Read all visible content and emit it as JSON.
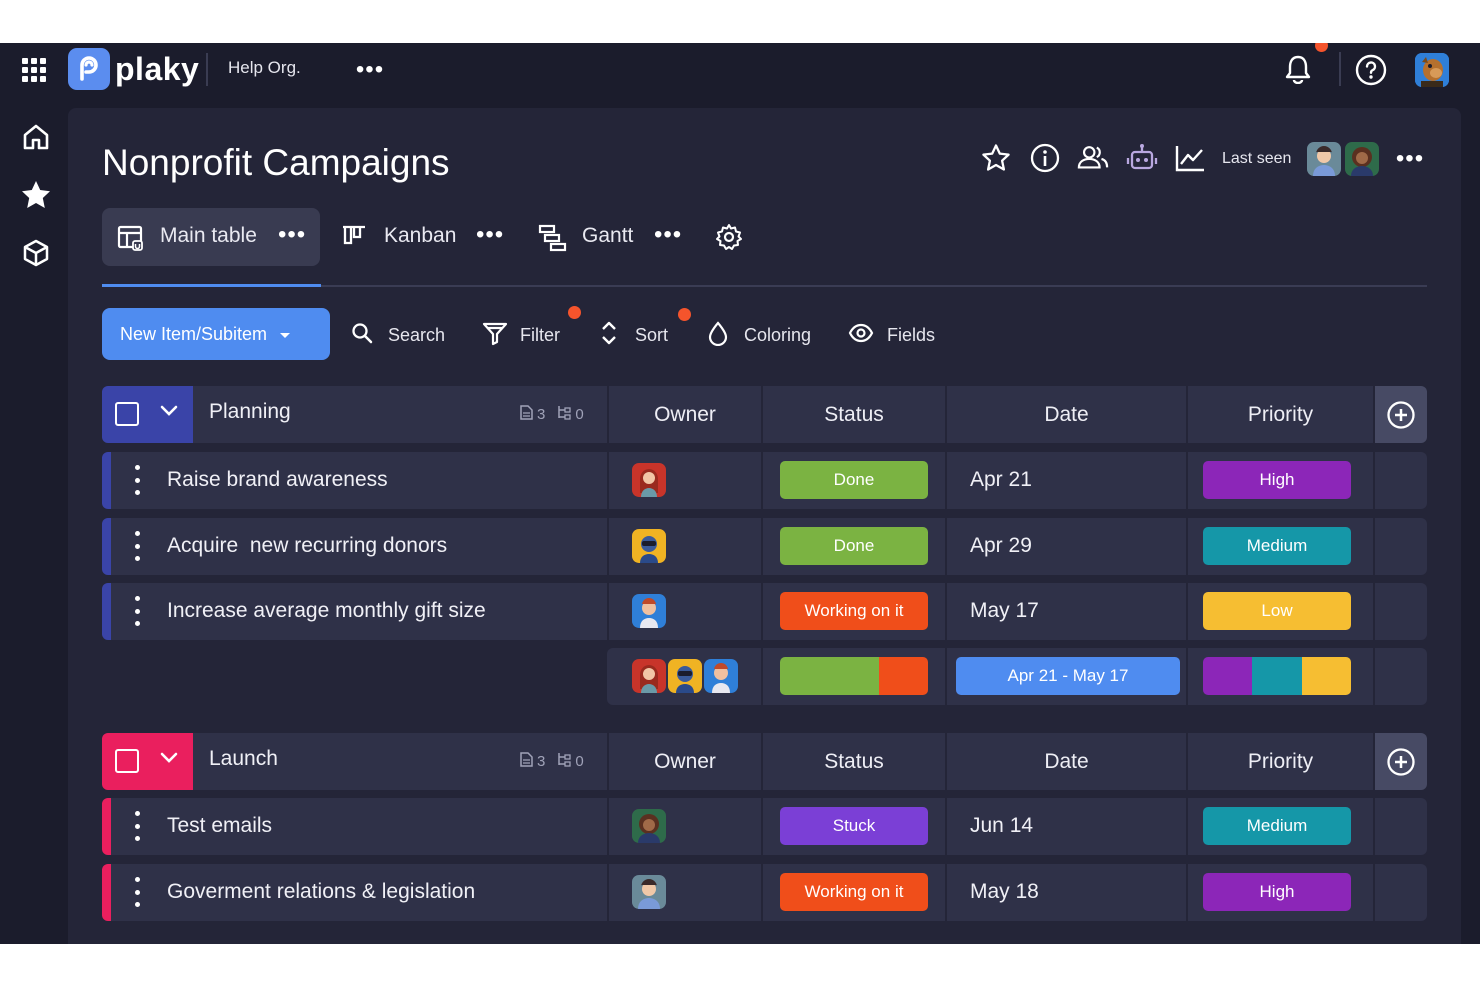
{
  "colors": {
    "accent": "#4f8cf0",
    "done": "#7bb342",
    "working": "#f04e1a",
    "stuck": "#7b3fd6",
    "high": "#8c26b8",
    "medium": "#1597a8",
    "low": "#f6be32",
    "date_range": "#4f8cf0",
    "planning_group": "#3a44a8",
    "launch_group": "#ea1f5e"
  },
  "topbar": {
    "app_icon": "grid-apps-icon",
    "logo_text": "plaky",
    "org_name": "Help Org.",
    "more": "•••",
    "icons": [
      "bell-icon",
      "help-icon",
      "user-avatar"
    ]
  },
  "sidebar": {
    "items": [
      "home-icon",
      "star-icon",
      "cube-icon"
    ]
  },
  "board": {
    "title": "Nonprofit Campaigns",
    "last_seen_label": "Last seen",
    "more": "•••",
    "header_icons": [
      "star-icon",
      "info-icon",
      "members-icon",
      "automation-icon",
      "activity-icon"
    ]
  },
  "views": [
    {
      "label": "Main table",
      "more": "•••"
    },
    {
      "label": "Kanban",
      "more": "•••"
    },
    {
      "label": "Gantt",
      "more": "•••"
    }
  ],
  "toolbar": {
    "new_item": "New Item/Subitem",
    "search": "Search",
    "filter": "Filter",
    "sort": "Sort",
    "coloring": "Coloring",
    "fields": "Fields"
  },
  "columns": {
    "owner": "Owner",
    "status": "Status",
    "date": "Date",
    "priority": "Priority"
  },
  "groups": [
    {
      "name": "Planning",
      "item_count": "3",
      "subitem_count": "0",
      "items": [
        {
          "name": "Raise brand awareness",
          "status": "Done",
          "date": "Apr 21",
          "priority": "High"
        },
        {
          "name": "Acquire  new recurring donors",
          "status": "Done",
          "date": "Apr 29",
          "priority": "Medium"
        },
        {
          "name": "Increase average monthly gift size",
          "status": "Working on it",
          "date": "May 17",
          "priority": "Low"
        }
      ],
      "summary": {
        "date_range": "Apr 21 - May 17",
        "status_split": {
          "Done": 2,
          "Working on it": 1
        },
        "priority_split": {
          "High": 1,
          "Medium": 1,
          "Low": 1
        }
      }
    },
    {
      "name": "Launch",
      "item_count": "3",
      "subitem_count": "0",
      "items": [
        {
          "name": "Test emails",
          "status": "Stuck",
          "date": "Jun 14",
          "priority": "Medium"
        },
        {
          "name": "Goverment relations & legislation",
          "status": "Working on it",
          "date": "May 18",
          "priority": "High"
        }
      ]
    }
  ]
}
